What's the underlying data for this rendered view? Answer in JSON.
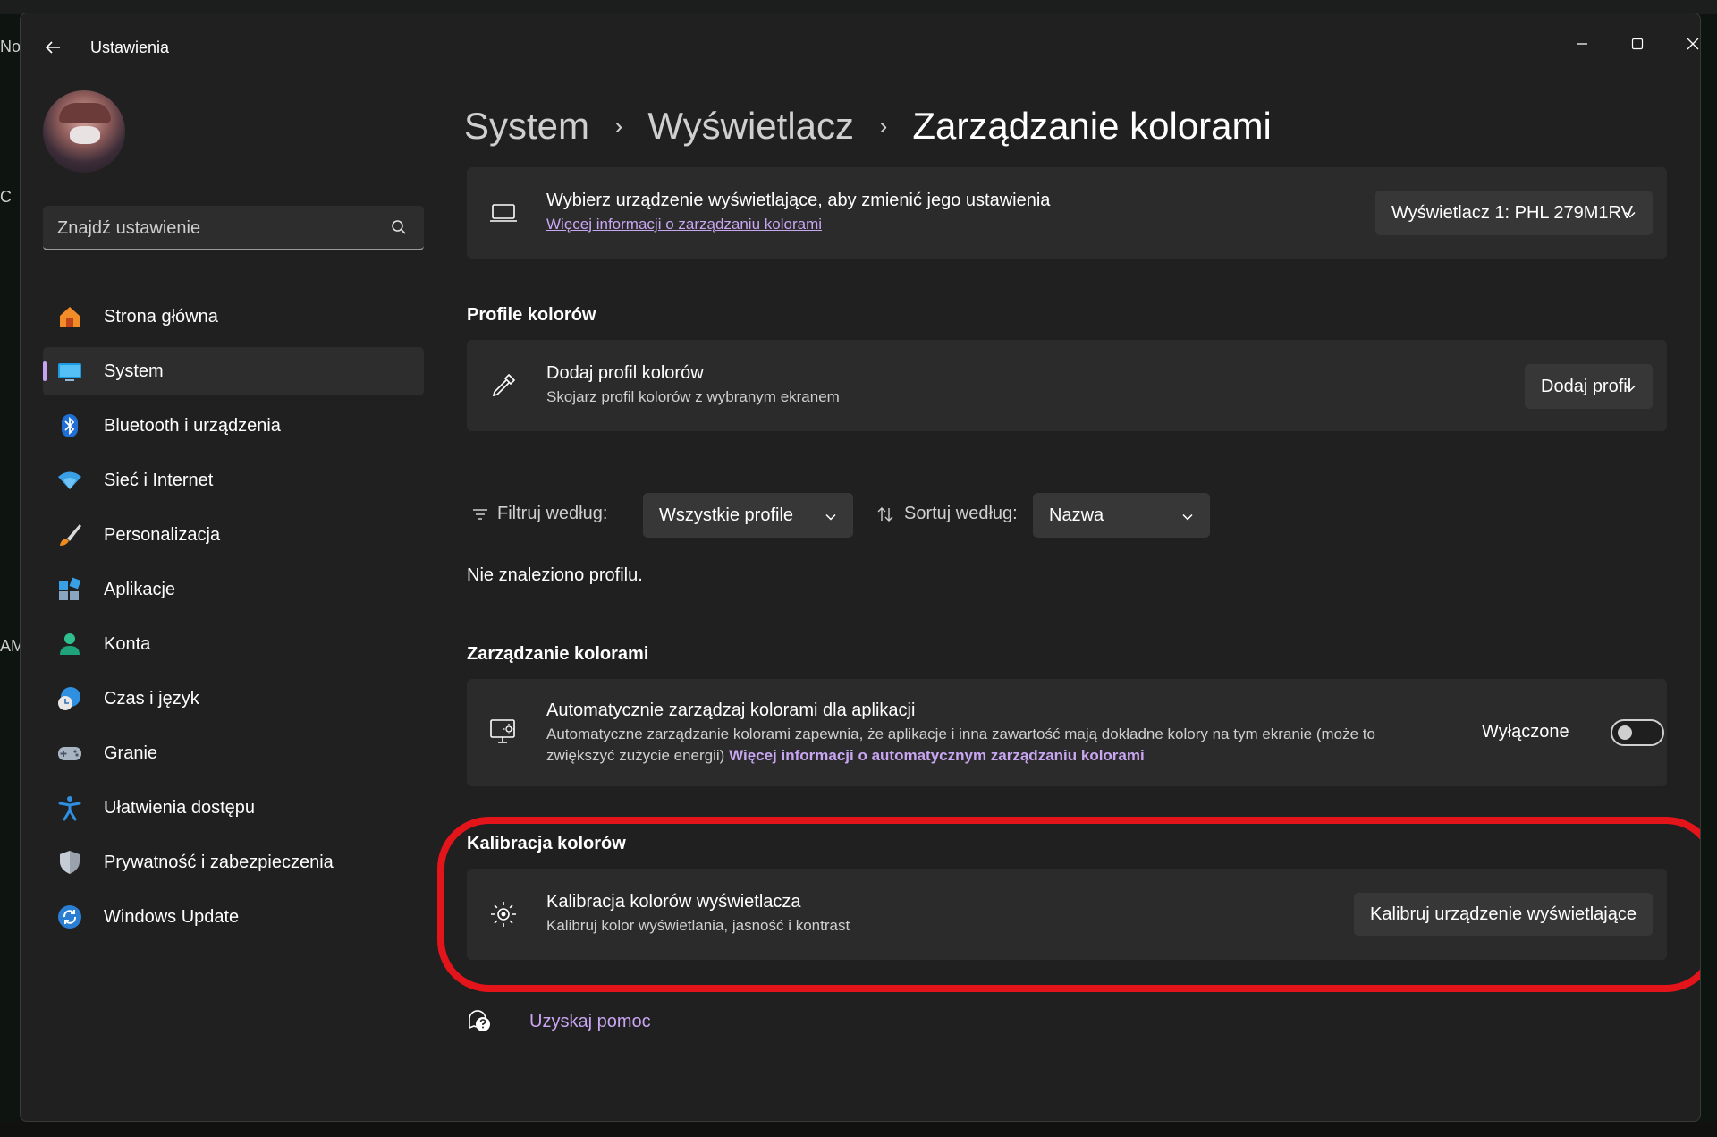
{
  "desktop": {
    "left_fragments": [
      "No",
      "C",
      "AM"
    ]
  },
  "window": {
    "app_title": "Ustawienia",
    "icons": {
      "back": "arrow-left-icon",
      "minimize": "minimize-icon",
      "maximize": "maximize-icon",
      "close": "close-icon"
    }
  },
  "sidebar": {
    "search_placeholder": "Znajdź ustawienie",
    "items": [
      {
        "label": "Strona główna",
        "icon": "home-icon",
        "active": false
      },
      {
        "label": "System",
        "icon": "system-display-icon",
        "active": true
      },
      {
        "label": "Bluetooth i urządzenia",
        "icon": "bluetooth-icon",
        "active": false
      },
      {
        "label": "Sieć i Internet",
        "icon": "wifi-icon",
        "active": false
      },
      {
        "label": "Personalizacja",
        "icon": "brush-icon",
        "active": false
      },
      {
        "label": "Aplikacje",
        "icon": "apps-icon",
        "active": false
      },
      {
        "label": "Konta",
        "icon": "account-icon",
        "active": false
      },
      {
        "label": "Czas i język",
        "icon": "clock-globe-icon",
        "active": false
      },
      {
        "label": "Granie",
        "icon": "gamepad-icon",
        "active": false
      },
      {
        "label": "Ułatwienia dostępu",
        "icon": "accessibility-icon",
        "active": false
      },
      {
        "label": "Prywatność i zabezpieczenia",
        "icon": "shield-icon",
        "active": false
      },
      {
        "label": "Windows Update",
        "icon": "windows-update-icon",
        "active": false
      }
    ]
  },
  "breadcrumb": {
    "items": [
      "System",
      "Wyświetlacz",
      "Zarządzanie kolorami"
    ],
    "separator": "›"
  },
  "device_card": {
    "title": "Wybierz urządzenie wyświetlające, aby zmienić jego ustawienia",
    "link": "Więcej informacji o zarządzaniu kolorami",
    "dropdown_value": "Wyświetlacz 1: PHL 279M1RV"
  },
  "profiles_section": {
    "heading": "Profile kolorów",
    "add_card": {
      "title": "Dodaj profil kolorów",
      "subtitle": "Skojarz profil kolorów z wybranym ekranem",
      "button": "Dodaj profil"
    },
    "filter_label": "Filtruj według:",
    "filter_value": "Wszystkie profile",
    "sort_label": "Sortuj według:",
    "sort_value": "Nazwa",
    "empty_text": "Nie znaleziono profilu."
  },
  "color_management": {
    "heading": "Zarządzanie kolorami",
    "title": "Automatycznie zarządzaj kolorami dla aplikacji",
    "desc_line1": "Automatyczne zarządzanie kolorami zapewnia, że aplikacje i inna zawartość mają dokładne kolory na tym ekranie (może to",
    "desc_line2": "zwiększyć zużycie energii)",
    "desc_link": "Więcej informacji o automatycznym zarządzaniu kolorami",
    "toggle_label": "Wyłączone",
    "toggle_on": false
  },
  "calibration": {
    "heading": "Kalibracja kolorów",
    "title": "Kalibracja kolorów wyświetlacza",
    "subtitle": "Kalibruj kolor wyświetlania, jasność i kontrast",
    "button": "Kalibruj urządzenie wyświetlające",
    "highlight_color": "#e4141b"
  },
  "help": {
    "label": "Uzyskaj pomoc"
  },
  "colors": {
    "accent": "#c9a6f2",
    "window_bg": "#202020",
    "card_bg": "#2b2b2b"
  }
}
